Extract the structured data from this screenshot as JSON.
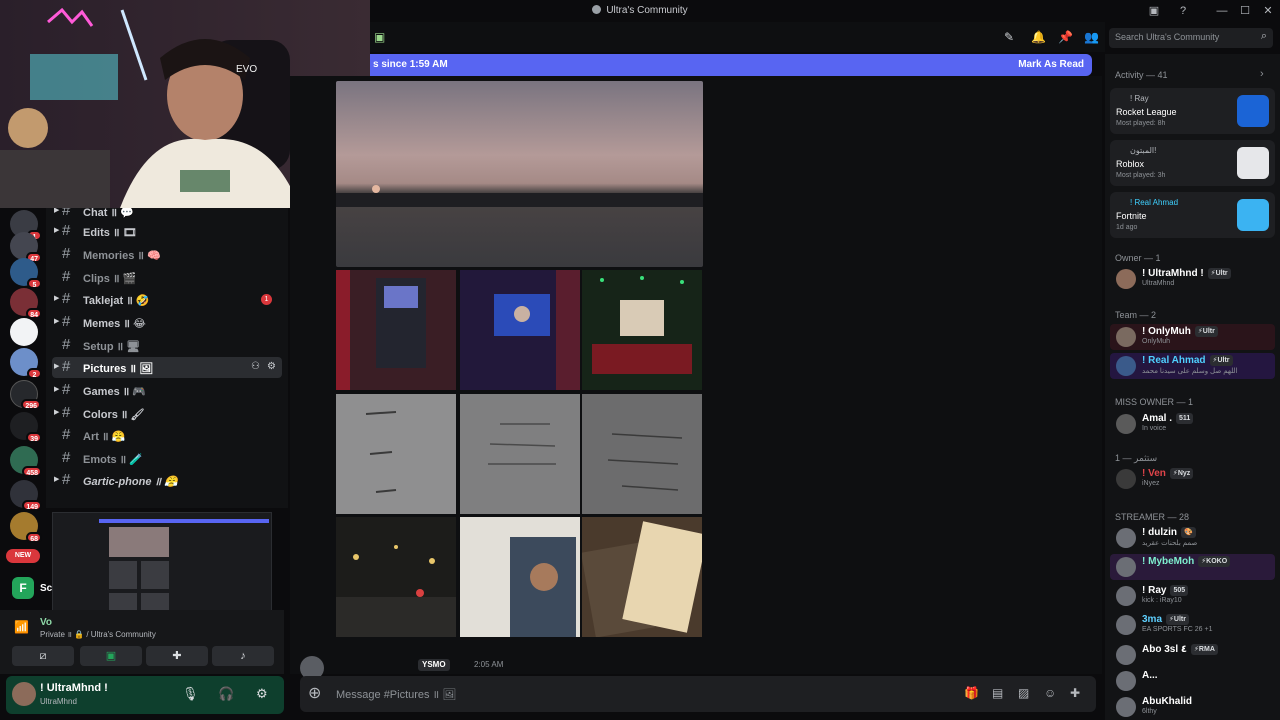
{
  "window": {
    "title": "Ultra's Community"
  },
  "banner": {
    "since": "s since 1:59 AM",
    "mark_read": "Mark As Read"
  },
  "search": {
    "placeholder": "Search Ultra's Community"
  },
  "server_badges": [
    "1",
    "47",
    "5",
    "84",
    "2",
    "296",
    "39",
    "458",
    "149",
    "68"
  ],
  "new_label": "NEW",
  "channels": [
    {
      "name": "Chat ॥ 💬",
      "badge": ""
    },
    {
      "name": "Edits ॥ 🎞",
      "badge": ""
    },
    {
      "name": "Memories ॥ 🧠",
      "badge": ""
    },
    {
      "name": "Clips ॥ 🎬",
      "badge": ""
    },
    {
      "name": "Taklejat ॥ 🤣",
      "badge": "1"
    },
    {
      "name": "Memes ॥ 😂",
      "badge": ""
    },
    {
      "name": "Setup ॥ 🖥",
      "badge": ""
    },
    {
      "name": "Pictures ॥ 🖼",
      "badge": ""
    },
    {
      "name": "Games ॥ 🎮",
      "badge": ""
    },
    {
      "name": "Colors ॥ 🖌",
      "badge": ""
    },
    {
      "name": "Art ॥ 😤",
      "badge": ""
    },
    {
      "name": "Emots ॥ 🧪",
      "badge": ""
    },
    {
      "name": "Gartic-phone ॥ 😤",
      "badge": ""
    }
  ],
  "voice": {
    "label": "Vo",
    "location": "Private ॥ 🔒 / Ultra's Community",
    "sc_label": "Sc"
  },
  "user": {
    "name": "! UltraMhnd !",
    "status": "UltraMhnd"
  },
  "composer": {
    "placeholder": "Message #Pictures ॥ 🖼"
  },
  "message": {
    "tag": "YSMO",
    "time": "2:05 AM"
  },
  "sidebar": {
    "activity_header": "Activity — 41",
    "activities": [
      {
        "who": "! Ray",
        "game": "Rocket League",
        "sub": "Most played: 8h"
      },
      {
        "who": "المبتون!",
        "game": "Roblox",
        "sub": "Most played: 3h"
      },
      {
        "who": "! Real Ahmad",
        "game": "Fortnite",
        "sub": "1d ago"
      }
    ],
    "groups": [
      {
        "header": "Owner — 1",
        "members": [
          {
            "name": "! UltraMhnd !",
            "tag": "⚡Ultr",
            "sub": "UltraMhnd"
          }
        ]
      },
      {
        "header": "Team — 2",
        "members": [
          {
            "name": "! OnlyMuh",
            "tag": "⚡Ultr",
            "sub": "OnlyMuh"
          },
          {
            "name": "! Real Ahmad",
            "tag": "⚡Ultr",
            "sub": "اللهم صل وسلم على سيدنا محمد"
          }
        ]
      },
      {
        "header": "MISS OWNER — 1",
        "members": [
          {
            "name": "Amal .",
            "tag": "511",
            "sub": "In voice"
          }
        ]
      },
      {
        "header": "ستثمر — 1",
        "members": [
          {
            "name": "! Ven",
            "tag": "⚡Nyz",
            "sub": "iNyez"
          }
        ]
      },
      {
        "header": "STREAMER — 28",
        "members": [
          {
            "name": "! dulzin",
            "tag": "🎨",
            "sub": "صمم بلحنات عقريد"
          },
          {
            "name": "! MybeMoh",
            "tag": "⚡KOKO",
            "sub": ""
          },
          {
            "name": "! Ray",
            "tag": "505",
            "sub": "kick : iRay10"
          },
          {
            "name": "3ma",
            "tag": "⚡Ultr",
            "sub": "EA SPORTS FC 26 +1"
          },
          {
            "name": "Abo 3sl ٤",
            "tag": "⚡RMA",
            "sub": ""
          },
          {
            "name": "A...",
            "tag": "",
            "sub": ""
          },
          {
            "name": "AbuKhalid",
            "tag": "",
            "sub": "6lthy"
          }
        ]
      }
    ]
  }
}
